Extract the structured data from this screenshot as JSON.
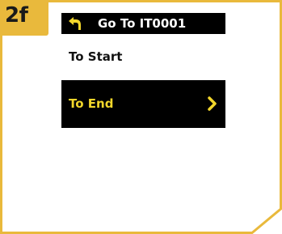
{
  "step": {
    "label": "2f"
  },
  "header": {
    "title": "Go To IT0001",
    "back_icon": "back-arrow-icon"
  },
  "menu": {
    "items": [
      {
        "label": "To Start",
        "selected": false
      },
      {
        "label": "To End",
        "selected": true,
        "icon": "chevron-right-icon"
      }
    ]
  },
  "colors": {
    "accent": "#e9b93c",
    "screen_bg": "#000000",
    "selected_text": "#f2d62b",
    "header_text": "#ffffff"
  }
}
